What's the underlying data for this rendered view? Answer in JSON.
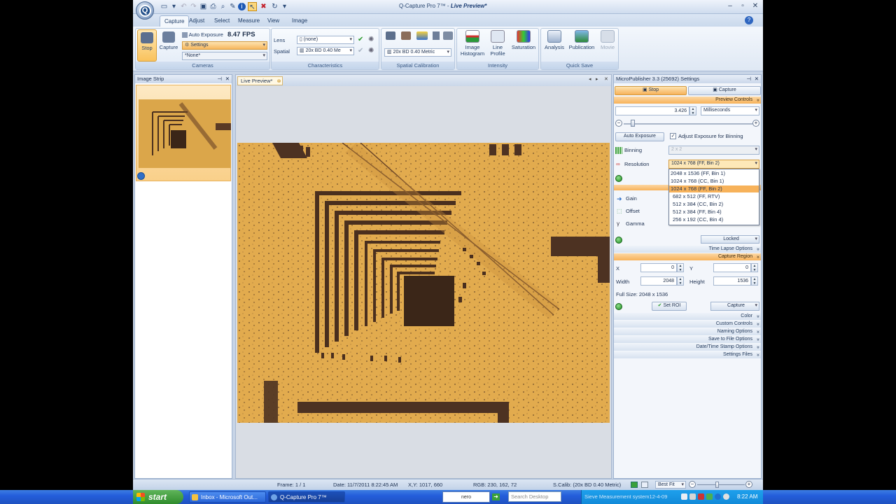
{
  "app": {
    "title_prefix": "Q-Capture Pro 7™ - ",
    "title_doc": "Live Preview*",
    "logo_letter": "Q"
  },
  "tabs": [
    "Capture",
    "Adjust",
    "Select",
    "Measure",
    "View",
    "Image"
  ],
  "ribbon": {
    "cameras": {
      "label": "Cameras",
      "stop": "Stop",
      "capture": "Capture",
      "auto_exposure": "Auto Exposure",
      "fps": "8.47 FPS",
      "settings": "Settings",
      "preset": "*None*"
    },
    "characteristics": {
      "label": "Characteristics",
      "lens_label": "Lens",
      "lens_value": "(none)",
      "spatial_label": "Spatial",
      "spatial_value": "20x BD 0.40 Me"
    },
    "spatial_calibration": {
      "label": "Spatial Calibration",
      "value": "20x BD 0.40 Metric"
    },
    "intensity": {
      "label": "Intensity",
      "histogram": "Image Histogram",
      "line_profile": "Line Profile",
      "saturation": "Saturation"
    },
    "quick_save": {
      "label": "Quick Save",
      "analysis": "Analysis",
      "publication": "Publication",
      "movie": "Movie"
    }
  },
  "image_strip": {
    "title": "Image Strip"
  },
  "live_tab": {
    "label": "Live Preview*"
  },
  "settings_panel": {
    "title": "MicroPublisher 3.3 (25692) Settings",
    "stop": "Stop",
    "capture": "Capture",
    "preview_controls": "Preview Controls",
    "exposure_value": "3.426",
    "exposure_unit": "Milliseconds",
    "auto_exposure_btn": "Auto Exposure",
    "adjust_binning": "Adjust Exposure for Binning",
    "binning_label": "Binning",
    "binning_value": "2 x 2",
    "resolution_label": "Resolution",
    "resolution_value": "1024 x 768 (FF,    Bin 2)",
    "resolution_options": [
      "2048 x 1536 (FF,   Bin 1)",
      "1024 x 768 (CC, Bin 1)",
      "1024 x 768 (FF,    Bin 2)",
      "682 x 512 (FF,     RTV)",
      "512 x 384 (CC,    Bin 2)",
      "512 x 384 (FF, Bin 4)",
      "256 x 192 (CC, Bin 4)"
    ],
    "selected_option_index": 2,
    "gain_label": "Gain",
    "offset_label": "Offset",
    "gamma_label": "Gamma",
    "locked": "Locked",
    "time_lapse": "Time Lapse Options",
    "capture_region": "Capture Region",
    "x_label": "X",
    "x_value": "0",
    "y_label": "Y",
    "y_value": "0",
    "width_label": "Width",
    "width_value": "2048",
    "height_label": "Height",
    "height_value": "1536",
    "full_size": "Full Size: 2048 x 1536",
    "set_roi": "Set ROI",
    "capture_btn": "Capture",
    "sections": [
      "Color",
      "Custom Controls",
      "Naming Options",
      "Save to File Options",
      "Date/Time Stamp Options",
      "Settings Files"
    ]
  },
  "statusbar": {
    "frame": "Frame: 1 / 1",
    "date": "Date: 11/7/2011 8:22:45 AM",
    "xy": "X,Y: 1017,   660",
    "rgb": "RGB:   230,   162,    72",
    "calib": "S.Calib: (20x BD 0.40 Metric)",
    "zoom": "Best Fit"
  },
  "taskbar": {
    "start": "start",
    "items": [
      "Inbox - Microsoft Out...",
      "Q-Capture Pro 7™"
    ],
    "search": "Search Desktop",
    "tray_text": "Sieve Measurement system12-4-09",
    "clock": "8:22 AM",
    "nero": "nero"
  },
  "colors": {
    "accent": "#f7b25a",
    "chrome": "#c7d4e6",
    "taskbar": "#245edb",
    "specimen": "#e0a94a"
  }
}
